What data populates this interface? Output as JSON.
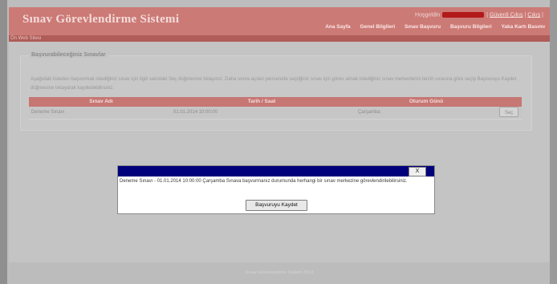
{
  "header": {
    "logo": "Sınav Görevlendirme Sistemi",
    "welcome": "Hoşgeldin",
    "logout": "Güvenli Çıkış",
    "exit": "Çıkış",
    "nav": [
      "Ana Sayfa",
      "Genel Bilgileri",
      "Sınav Başvuru",
      "Başvuru Bilgileri",
      "Yaka Kartı Basımı"
    ]
  },
  "breadcrumb": "Ön Web Sitesi",
  "section": {
    "legend": "Başvurabileceğiniz Sınavlar",
    "description": "Aşağıdaki listeden başvurmak istediğiniz sınav için ilgili satırdaki Seç düğmesine tıklayınız. Daha sonra açılan pencerede seçtiğiniz sınav için görev almak istediğiniz sınav merkezlerini tercih sırasına göre seçip Başvuruyu Kaydet düğmesine tıklayarak kaydedebilirsiniz."
  },
  "table": {
    "columns": [
      "Sınav Adı",
      "Tarih / Saat",
      "Oturum Günü"
    ],
    "rows": [
      {
        "name": "Deneme Sınavı",
        "date": "01.01.2014 10:00:00",
        "day": "Çarşamba",
        "action": "Seç"
      }
    ]
  },
  "footer": "Sınav Görevlendirme Sistemi 2013",
  "modal": {
    "close": "X",
    "message": "Deneme Sınavı - 01.01.2014 10:00:00 Çarşamba Sınava başvurmanız durumunda herhangi bir sınav merkezine görevlendirilebilirsiniz.",
    "button": "Başvuruyu Kaydet"
  }
}
